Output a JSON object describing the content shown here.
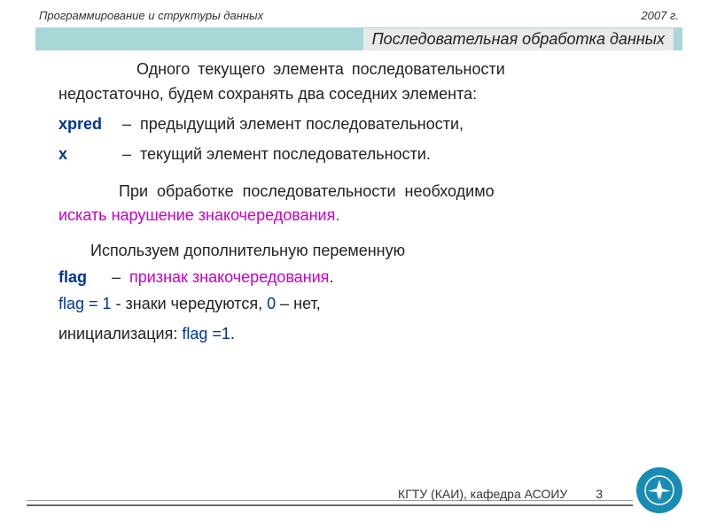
{
  "header": {
    "left": "Программирование и структуры данных",
    "right": "2007 г."
  },
  "subtitle": "Последовательная обработка данных",
  "para1a": "Одного текущего элемента последовательности",
  "para1b": "недостаточно, будем сохранять два соседних элемента:",
  "vars": {
    "xpred": {
      "name": "xpred",
      "dash": "–",
      "desc": "предыдущий элемент последовательности,"
    },
    "x": {
      "name": "x",
      "dash": "–",
      "desc": "текущий элемент последовательности."
    }
  },
  "para2": "При обработке последовательности необходимо",
  "para2m": "искать нарушение знакочередования.",
  "para3": "Используем дополнительную переменную",
  "flagline": {
    "name": "flag",
    "dash": "–",
    "desc": "признак знакочередования",
    "dot": "."
  },
  "flag1": {
    "a": "flag = 1",
    "b": " - знаки чередуются, ",
    "c": "0",
    "d": " – нет,"
  },
  "init": {
    "a": "инициализация: ",
    "b": "flag =1",
    "c": "."
  },
  "footer": {
    "org": "КГТУ (КАИ), кафедра АСОИУ",
    "page": "3"
  }
}
